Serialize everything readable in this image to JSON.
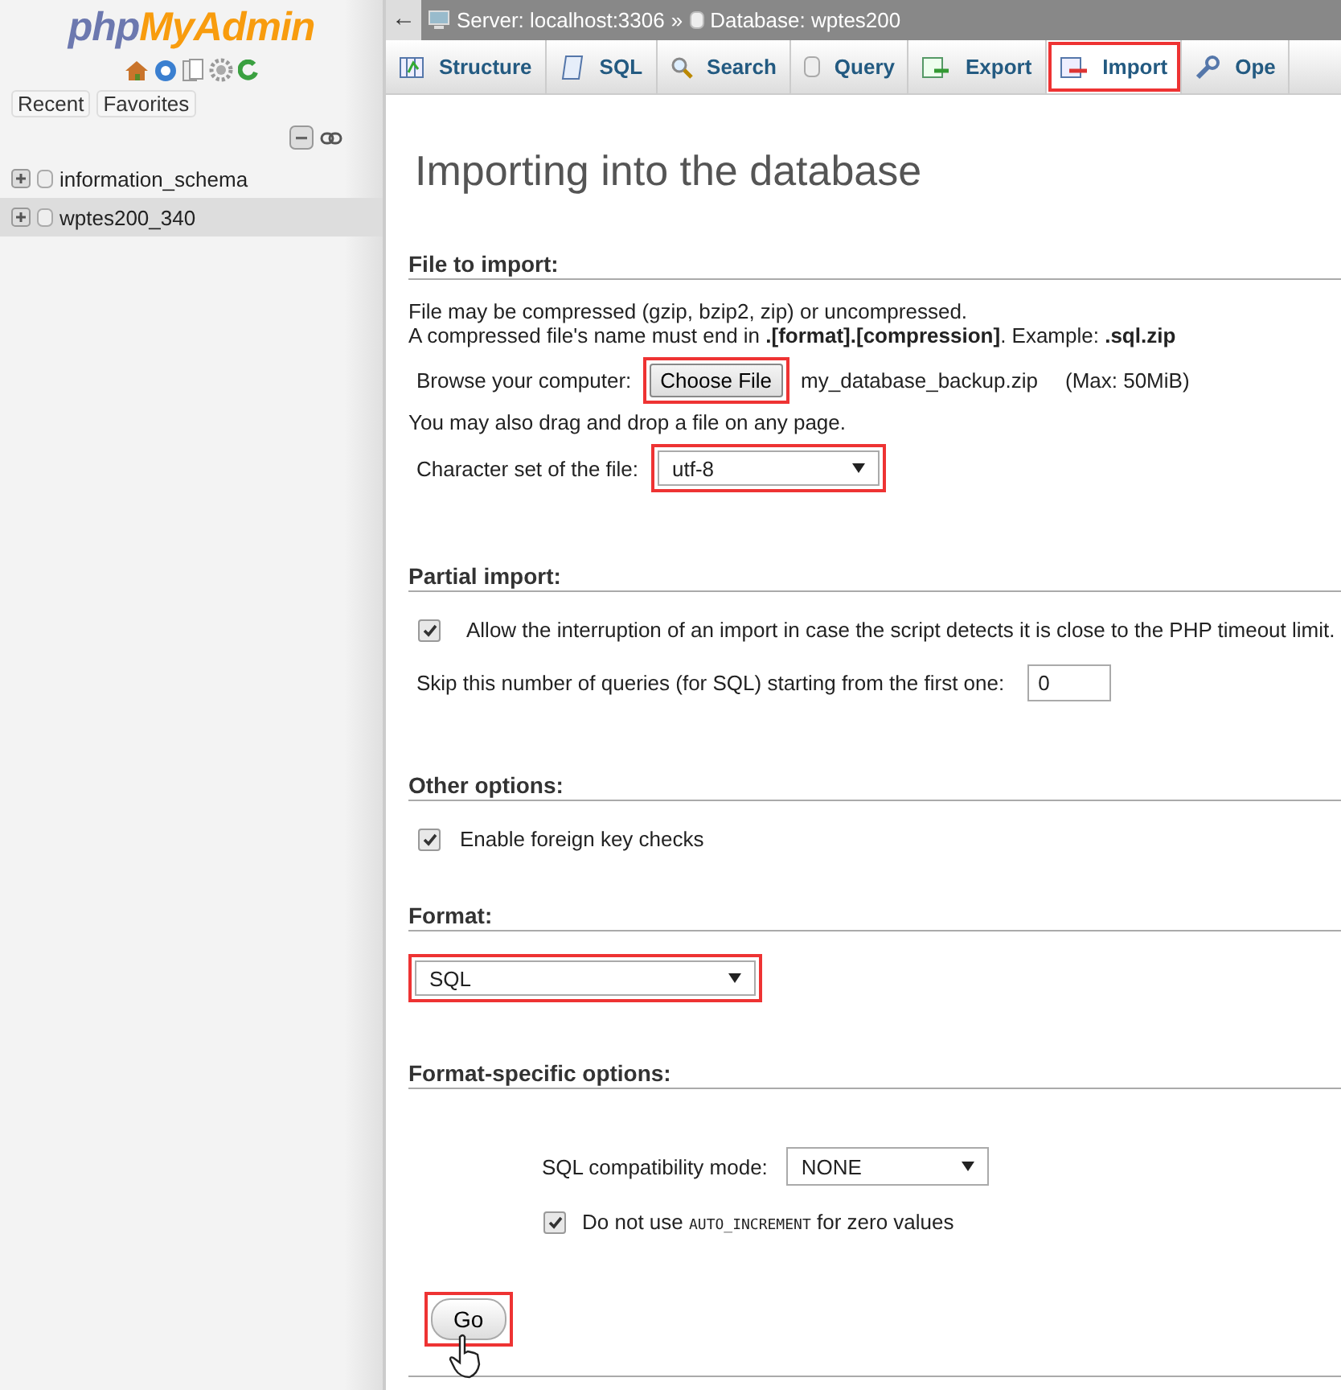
{
  "sidebar": {
    "logo_left": "php",
    "logo_right": "MyAdmin",
    "buttons": [
      "Recent",
      "Favorites"
    ],
    "databases": [
      {
        "name": "information_schema",
        "selected": false
      },
      {
        "name": "wptes200_340",
        "selected": true
      }
    ]
  },
  "breadcrumb": {
    "back": "←",
    "server": "Server: localhost:3306",
    "separator": "»",
    "database": "Database: wptes200"
  },
  "tabs": [
    {
      "label": "Structure",
      "selected": false,
      "highlighted": false
    },
    {
      "label": "SQL",
      "selected": false,
      "highlighted": false
    },
    {
      "label": "Search",
      "selected": false,
      "highlighted": false
    },
    {
      "label": "Query",
      "selected": false,
      "highlighted": false
    },
    {
      "label": "Export",
      "selected": false,
      "highlighted": false
    },
    {
      "label": "Import",
      "selected": true,
      "highlighted": true
    },
    {
      "label": "Ope",
      "selected": false,
      "highlighted": false
    }
  ],
  "title": "Importing into the database",
  "file_section": {
    "heading": "File to import:",
    "note_1": "File may be compressed (gzip, bzip2, zip) or uncompressed.",
    "note_2": "A compressed file's name must end in **.[format].[compression]**. Example: **.sql.zip**",
    "browse_label": "Browse your computer:",
    "choose_button": {
      "label": "Choose File",
      "highlighted": true
    },
    "file_name": "my_database_backup.zip",
    "max_size": "(Max: 50MiB)",
    "drag_note": "You may also drag and drop a file on any page.",
    "charset_label": "Character set of the file:",
    "charset": {
      "value": "utf-8",
      "highlighted": true
    }
  },
  "partial_section": {
    "heading": "Partial import:",
    "allow_interrupt": {
      "label": "Allow the interruption of an import in case the script detects it is close to the PHP timeout limit.",
      "checked": true
    },
    "skip_label": "Skip this number of queries (for SQL) starting from the first one:",
    "skip_value": "0"
  },
  "other_section": {
    "heading": "Other options:",
    "foreign_keys": {
      "label": "Enable foreign key checks",
      "checked": true
    }
  },
  "format_section": {
    "heading": "Format:",
    "format": {
      "value": "SQL",
      "highlighted": true
    }
  },
  "format_options": {
    "heading": "Format-specific options:",
    "compat_label": "SQL compatibility mode:",
    "compat_value": "NONE",
    "auto_increment": {
      "label_before": "Do not use",
      "code": "AUTO_INCREMENT",
      "label_after": "for zero values",
      "checked": true
    }
  },
  "go_button": {
    "label": "Go",
    "highlighted": true
  }
}
